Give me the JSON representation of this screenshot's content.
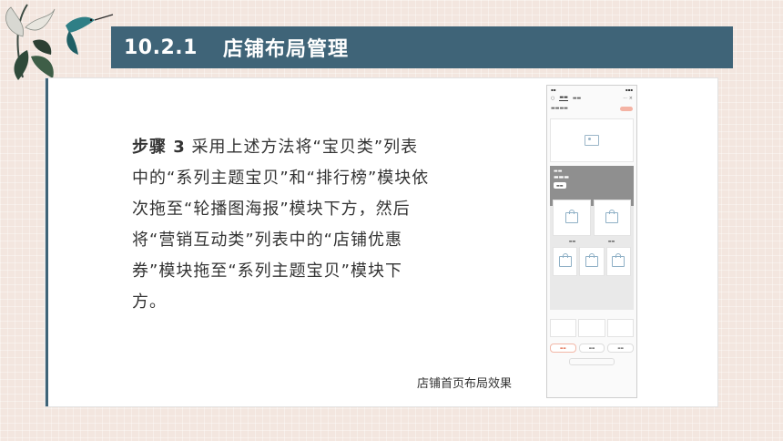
{
  "header": {
    "section_number": "10.2.1",
    "section_title": "店铺布局管理"
  },
  "content": {
    "step_label": "步骤 3",
    "step_text": "  采用上述方法将“宝贝类”列表中的“系列主题宝贝”和“排行榜”模块依次拖至“轮播图海报”模块下方，然后将“营销互动类”列表中的“店铺优惠券”模块拖至“系列主题宝贝”模块下方。"
  },
  "figure": {
    "caption": "店铺首页布局效果"
  },
  "colors": {
    "title_bar": "#3f6478",
    "background": "#f3e6df",
    "accent_orange": "#e06a4a"
  },
  "icons": [
    "hummingbird-flower-decoration",
    "image-placeholder-icon",
    "shopping-bag-icon"
  ]
}
